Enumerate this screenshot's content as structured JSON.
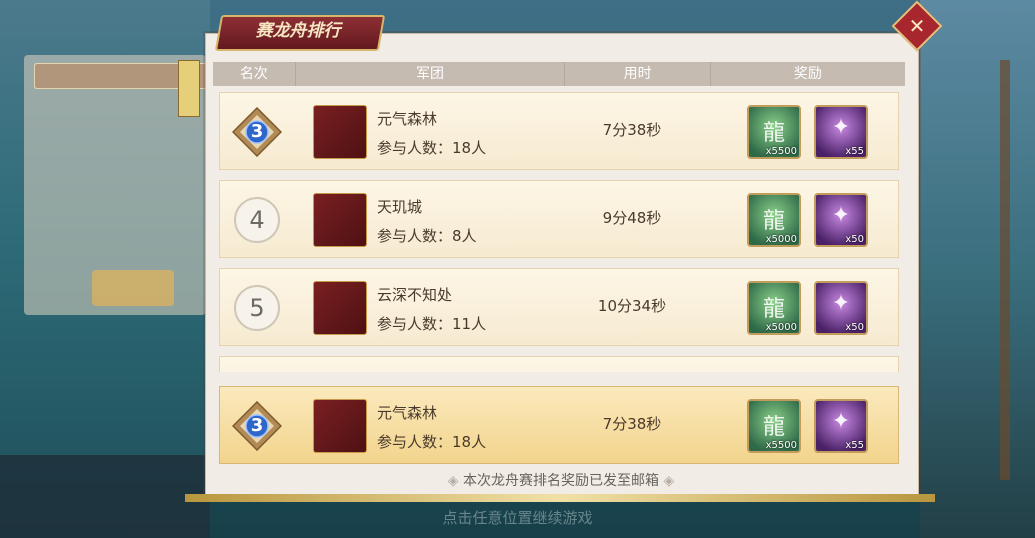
{
  "dialog": {
    "title": "赛龙舟排行",
    "close_glyph": "✕"
  },
  "table": {
    "headers": {
      "rank": "名次",
      "guild": "军团",
      "time": "用时",
      "reward": "奖励"
    },
    "rows": [
      {
        "rank": "3",
        "name": "元气森林",
        "members": "参与人数：18人",
        "time": "7分38秒",
        "rewards": [
          {
            "icon": "jade-dragon-icon",
            "count": "x5500"
          },
          {
            "icon": "purple-scroll-icon",
            "count": "x55"
          }
        ]
      },
      {
        "rank": "4",
        "name": "天玑城",
        "members": "参与人数：8人",
        "time": "9分48秒",
        "rewards": [
          {
            "icon": "jade-dragon-icon",
            "count": "x5000"
          },
          {
            "icon": "purple-scroll-icon",
            "count": "x50"
          }
        ]
      },
      {
        "rank": "5",
        "name": "云深不知处",
        "members": "参与人数：11人",
        "time": "10分34秒",
        "rewards": [
          {
            "icon": "jade-dragon-icon",
            "count": "x5000"
          },
          {
            "icon": "purple-scroll-icon",
            "count": "x50"
          }
        ]
      }
    ],
    "mine": {
      "rank": "3",
      "name": "元气森林",
      "members": "参与人数：18人",
      "time": "7分38秒",
      "rewards": [
        {
          "icon": "jade-dragon-icon",
          "count": "x5500"
        },
        {
          "icon": "purple-scroll-icon",
          "count": "x55"
        }
      ]
    }
  },
  "footer_note": "本次龙舟赛排名奖励已发至邮箱",
  "continue_hint": "点击任意位置继续游戏",
  "colors": {
    "accent": "#8e2f34",
    "gold": "#d7b56a",
    "highlight": "#f2d48c"
  }
}
